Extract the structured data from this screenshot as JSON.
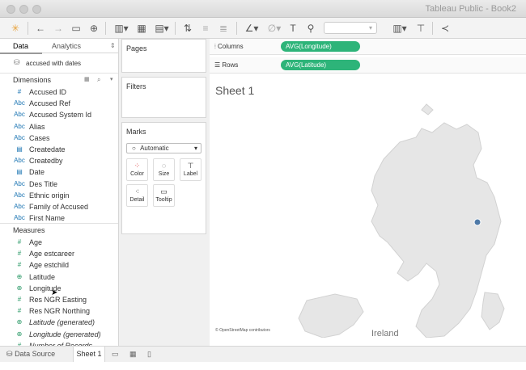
{
  "window": {
    "title": "Tableau Public - Book2"
  },
  "toolbar": {
    "icons": [
      "tableau-logo-icon",
      "back-icon",
      "forward-icon",
      "save-icon",
      "new-datasource-icon",
      "new-worksheet-icon",
      "duplicate-icon",
      "clear-icon",
      "swap-icon",
      "sort-asc-icon",
      "sort-desc-icon",
      "highlight-icon",
      "group-icon",
      "label-icon",
      "pin-icon",
      "fit-dropdown",
      "show-me-icon",
      "presentation-icon",
      "share-icon"
    ]
  },
  "left": {
    "tabs": [
      "Data",
      "Analytics"
    ],
    "datasource": "accused with dates",
    "dimensions_label": "Dimensions",
    "dimensions": [
      {
        "type": "#",
        "name": "Accused ID"
      },
      {
        "type": "Abc",
        "name": "Accused Ref"
      },
      {
        "type": "Abc",
        "name": "Accused System Id"
      },
      {
        "type": "Abc",
        "name": "Alias"
      },
      {
        "type": "Abc",
        "name": "Cases"
      },
      {
        "type": "date",
        "name": "Createdate"
      },
      {
        "type": "Abc",
        "name": "Createdby"
      },
      {
        "type": "date",
        "name": "Date"
      },
      {
        "type": "Abc",
        "name": "Des Title"
      },
      {
        "type": "Abc",
        "name": "Ethnic origin"
      },
      {
        "type": "Abc",
        "name": "Family of Accused"
      },
      {
        "type": "Abc",
        "name": "First Name"
      }
    ],
    "measures_label": "Measures",
    "measures": [
      {
        "type": "#",
        "name": "Age"
      },
      {
        "type": "#",
        "name": "Age estcareer"
      },
      {
        "type": "#",
        "name": "Age estchild"
      },
      {
        "type": "geo",
        "name": "Latitude"
      },
      {
        "type": "geo",
        "name": "Longitude"
      },
      {
        "type": "#",
        "name": "Res NGR Easting"
      },
      {
        "type": "#",
        "name": "Res NGR Northing"
      },
      {
        "type": "geo",
        "name": "Latitude (generated)",
        "italic": true
      },
      {
        "type": "geo",
        "name": "Longitude (generated)",
        "italic": true
      },
      {
        "type": "#",
        "name": "Number of Records",
        "italic": true
      }
    ]
  },
  "middle": {
    "pages": "Pages",
    "filters": "Filters",
    "marks": "Marks",
    "mark_type": "Automatic",
    "mark_buttons": [
      "Color",
      "Size",
      "Label",
      "Detail",
      "Tooltip"
    ]
  },
  "right": {
    "columns_label": "Columns",
    "rows_label": "Rows",
    "columns_pill": "AVG(Longitude)",
    "rows_pill": "AVG(Latitude)",
    "sheet_title": "Sheet 1",
    "attribution": "© OpenStreetMap contributors",
    "map_label": "Ireland",
    "point_color": "#4e79a7"
  },
  "bottom": {
    "datasource_tab": "Data Source",
    "sheet_tab": "Sheet 1"
  },
  "colors": {
    "pill": "#2db479",
    "accent": "#1f77b4"
  }
}
